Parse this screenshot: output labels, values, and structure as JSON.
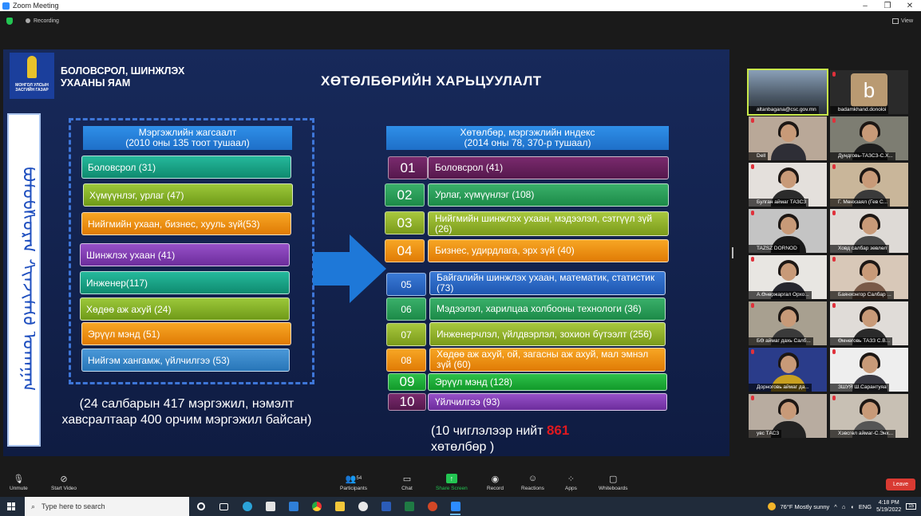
{
  "window": {
    "title": "Zoom Meeting",
    "controls": [
      "–",
      "❐",
      "✕"
    ]
  },
  "topbar": {
    "recording": "Recording",
    "view": "View"
  },
  "slide": {
    "emblem_caption": "МОНГОЛ УЛСЫН ЗАСГИЙН ГАЗАР",
    "ministry_line1": "БОЛОВСРОЛ, ШИНЖЛЭХ",
    "ministry_line2": "УХААНЫ ЯАМ",
    "title": "ХӨТӨЛБӨРИЙН ХАРЬЦУУЛАЛТ",
    "vertical_script": "ᠪᠣᠯᠣᠪᠰᠤᠷᠠᠯ ᠰᠢᠨᠵᠢᠯᠡᠬᠦ ᠤᠬᠠᠭᠠᠨ",
    "left_header_line1": "Мэргэжлийн жагсаалт",
    "left_header_line2": "(2010 оны 135 тоот тушаал)",
    "left_items": [
      "Боловсрол (31)",
      "Хүмүүнлэг, урлаг (47)",
      "Нийгмийн ухаан, бизнес, хууль зүй(53)",
      "Шинжлэх ухаан (41)",
      "Инженер(117)",
      "Хөдөө аж ахуй (24)",
      "Эрүүл мэнд (51)",
      "Нийгэм хангамж, үйлчилгээ (53)"
    ],
    "right_header_line1": "Хөтөлбөр, мэргэжлийн индекс",
    "right_header_line2": "(2014 оны  78, 370-р тушаал)",
    "right_numbers": [
      "01",
      "02",
      "03",
      "04",
      "05",
      "06",
      "07",
      "08",
      "09",
      "10"
    ],
    "right_items": [
      "Боловсрол (41)",
      "Урлаг, хүмүүнлэг (108)",
      "Нийгмийн шинжлэх ухаан, мэдээлэл, сэтгүүл зүй (26)",
      "Бизнес, удирдлага, эрх зүй (40)",
      "Байгалийн шинжлэх ухаан, математик, статистик (73)",
      "Мэдээлэл, харилцаа холбооны  технологи (36)",
      "Инженерчлэл, үйлдвэрлэл, зохион бүтээлт (256)",
      "Хөдөө аж ахуй, ой, загасны аж ахуй, мал эмнэл зүй (60)",
      "Эрүүл мэнд (128)",
      "Үйлчилгээ (93)"
    ],
    "note_left": "(24 салбарын 417 мэргэжил, нэмэлт хавсралтаар 400 орчим мэргэжил байсан)",
    "note_right_prefix": "(10  чиглэлээр нийт ",
    "note_right_number": "861",
    "note_right_suffix": "хөтөлбөр )"
  },
  "participants": [
    "altanbagana@csc.gov.mn",
    "badamkhand.donoloi",
    "Dell",
    "Дундговь-ТАЗСЗ-С.Х...",
    "Булган аймаг ТАЗСЗ",
    "Г. Мөнхзаял (Гев С...",
    "TAZSZ DORNOD",
    "Ховд салбар зөвлөл",
    "А.Өнөржаргал Орхо...",
    "Баянхонгор Салбар ...",
    "БӨ аймаг дахь Салб...",
    "Өмнөговь ТАЗЗ С.В...",
    "Дорноговь аймаг да...",
    "ЗШУЯ  Ш.Сарантуяа",
    "увс ТАСЗ",
    "Хэвсгөл аймаг-С.Энх..."
  ],
  "avatar_letter": "b",
  "toolbar": {
    "unmute": "Unmute",
    "start_video": "Start Video",
    "participants": "Participants",
    "participants_count": "54",
    "chat": "Chat",
    "share_screen": "Share Screen",
    "record": "Record",
    "reactions": "Reactions",
    "apps": "Apps",
    "whiteboards": "Whiteboards",
    "leave": "Leave"
  },
  "taskbar": {
    "search_placeholder": "Type here to search",
    "weather": "76°F  Mostly sunny",
    "lang": "ENG",
    "time": "4:18 PM",
    "date": "5/19/2022",
    "notif_count": "15"
  }
}
